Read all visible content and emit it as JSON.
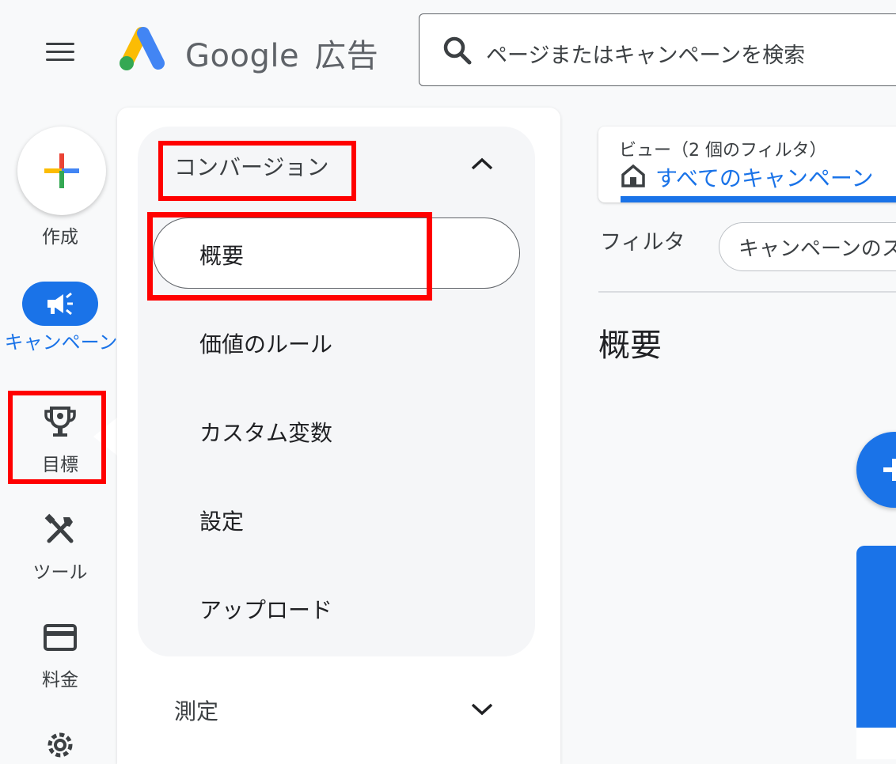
{
  "header": {
    "brand_google": "Google",
    "brand_product": "広告",
    "search_placeholder": "ページまたはキャンペーンを検索"
  },
  "rail": {
    "create_label": "作成",
    "campaigns_label": "キャンペーン",
    "goals_label": "目標",
    "tools_label": "ツール",
    "billing_label": "料金"
  },
  "menu": {
    "conversions_title": "コンバージョン",
    "items": [
      "概要",
      "価値のルール",
      "カスタム変数",
      "設定",
      "アップロード"
    ],
    "measurement_title": "測定"
  },
  "main": {
    "view_label": "ビュー（2 個のフィルタ）",
    "view_value": "すべてのキャンペーン",
    "filter_label": "フィルタ",
    "filter_chip": "キャンペーンのス",
    "page_title": "概要"
  },
  "colors": {
    "accent": "#1a73e8",
    "highlight": "#ff0000",
    "text": "#3c4043"
  },
  "icons": [
    "menu-icon",
    "google-ads-logo",
    "search-icon",
    "plus-icon",
    "megaphone-icon",
    "trophy-icon",
    "tools-icon",
    "credit-card-icon",
    "gear-icon",
    "chevron-up-icon",
    "chevron-down-icon",
    "home-icon"
  ]
}
